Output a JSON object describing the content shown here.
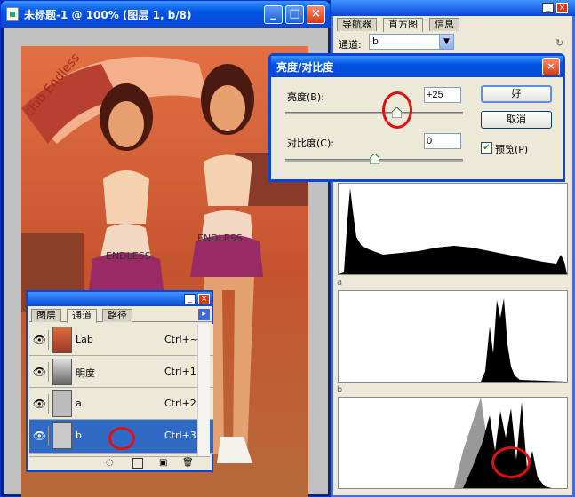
{
  "document_window": {
    "title": "未标题-1 @ 100% (图层 1, b/8)",
    "minimize": "_",
    "maximize": "□",
    "close": "×"
  },
  "photo": {
    "umbrella_text": "club Endless",
    "skirt_text_left": "ENDLESS",
    "skirt_text_right": "ENDLESS"
  },
  "channels_panel": {
    "tabs": [
      "图层",
      "通道",
      "路径"
    ],
    "active_tab": "通道",
    "menu_arrow": "▸",
    "rows": [
      {
        "name": "Lab",
        "shortcut": "Ctrl+~",
        "selected": false
      },
      {
        "name": "明度",
        "shortcut": "Ctrl+1",
        "selected": false
      },
      {
        "name": "a",
        "shortcut": "Ctrl+2",
        "selected": false
      },
      {
        "name": "b",
        "shortcut": "Ctrl+3",
        "selected": true
      }
    ]
  },
  "right_panel": {
    "tabs": [
      "导航器",
      "直方图",
      "信息"
    ],
    "active_tab": "直方图",
    "channel_label": "通道:",
    "channel_value": "b",
    "histogram_labels": [
      "a",
      "b"
    ]
  },
  "dialog": {
    "title": "亮度/对比度",
    "brightness_label": "亮度(B):",
    "brightness_value": "+25",
    "contrast_label": "对比度(C):",
    "contrast_value": "0",
    "ok_label": "好",
    "cancel_label": "取消",
    "preview_label": "预览(P)",
    "preview_checked": true,
    "close": "×"
  },
  "colors": {
    "xp_blue": "#0a46d6",
    "selection_blue": "#316ac5",
    "dialog_bg": "#ece9d8",
    "annotation_red": "#e01010"
  }
}
